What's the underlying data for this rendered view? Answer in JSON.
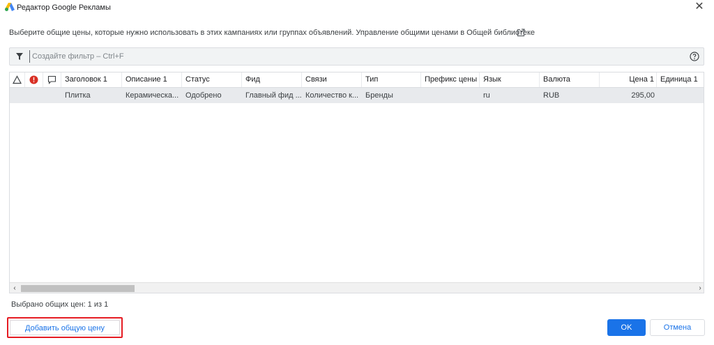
{
  "window": {
    "title": "Редактор Google Рекламы",
    "logo_icon": "google-ads-logo-icon",
    "close_icon": "close-icon",
    "close_glyph": "✕"
  },
  "intro": {
    "text": "Выберите общие цены, которые нужно использовать в этих кампаниях или группах объявлений. Управление общими ценами в Общей библиотеке",
    "link_icon": "external-link-icon"
  },
  "filter": {
    "placeholder": "Создайте фильтр – Ctrl+F",
    "filter_icon": "funnel-icon",
    "help_icon": "help-circle-icon"
  },
  "grid": {
    "header_icons": [
      "warning-triangle-icon",
      "error-circle-icon",
      "comment-icon"
    ],
    "columns": {
      "headline1": "Заголовок 1",
      "description1": "Описание 1",
      "status": "Статус",
      "feed": "Фид",
      "links": "Связи",
      "type": "Тип",
      "price_prefix": "Префикс цены",
      "language": "Язык",
      "currency": "Валюта",
      "price1": "Цена 1",
      "unit1": "Единица 1"
    },
    "rows": [
      {
        "headline1": "Плитка",
        "description1": "Керамическа...",
        "status": "Одобрено",
        "feed": "Главный фид ...",
        "links": "Количество к...",
        "type": "Бренды",
        "price_prefix": "",
        "language": "ru",
        "currency": "RUB",
        "price1": "295,00",
        "unit1": ""
      }
    ],
    "scroll_left_glyph": "‹",
    "scroll_right_glyph": "›"
  },
  "status": {
    "selected_text": "Выбрано общих цен: 1 из 1"
  },
  "footer": {
    "add_label": "Добавить общую цену",
    "ok_label": "OK",
    "cancel_label": "Отмена"
  },
  "colors": {
    "accent": "#1a73e8",
    "highlight_border": "#e51c23",
    "error_badge": "#d93025",
    "row_selected": "#e8eaed"
  }
}
